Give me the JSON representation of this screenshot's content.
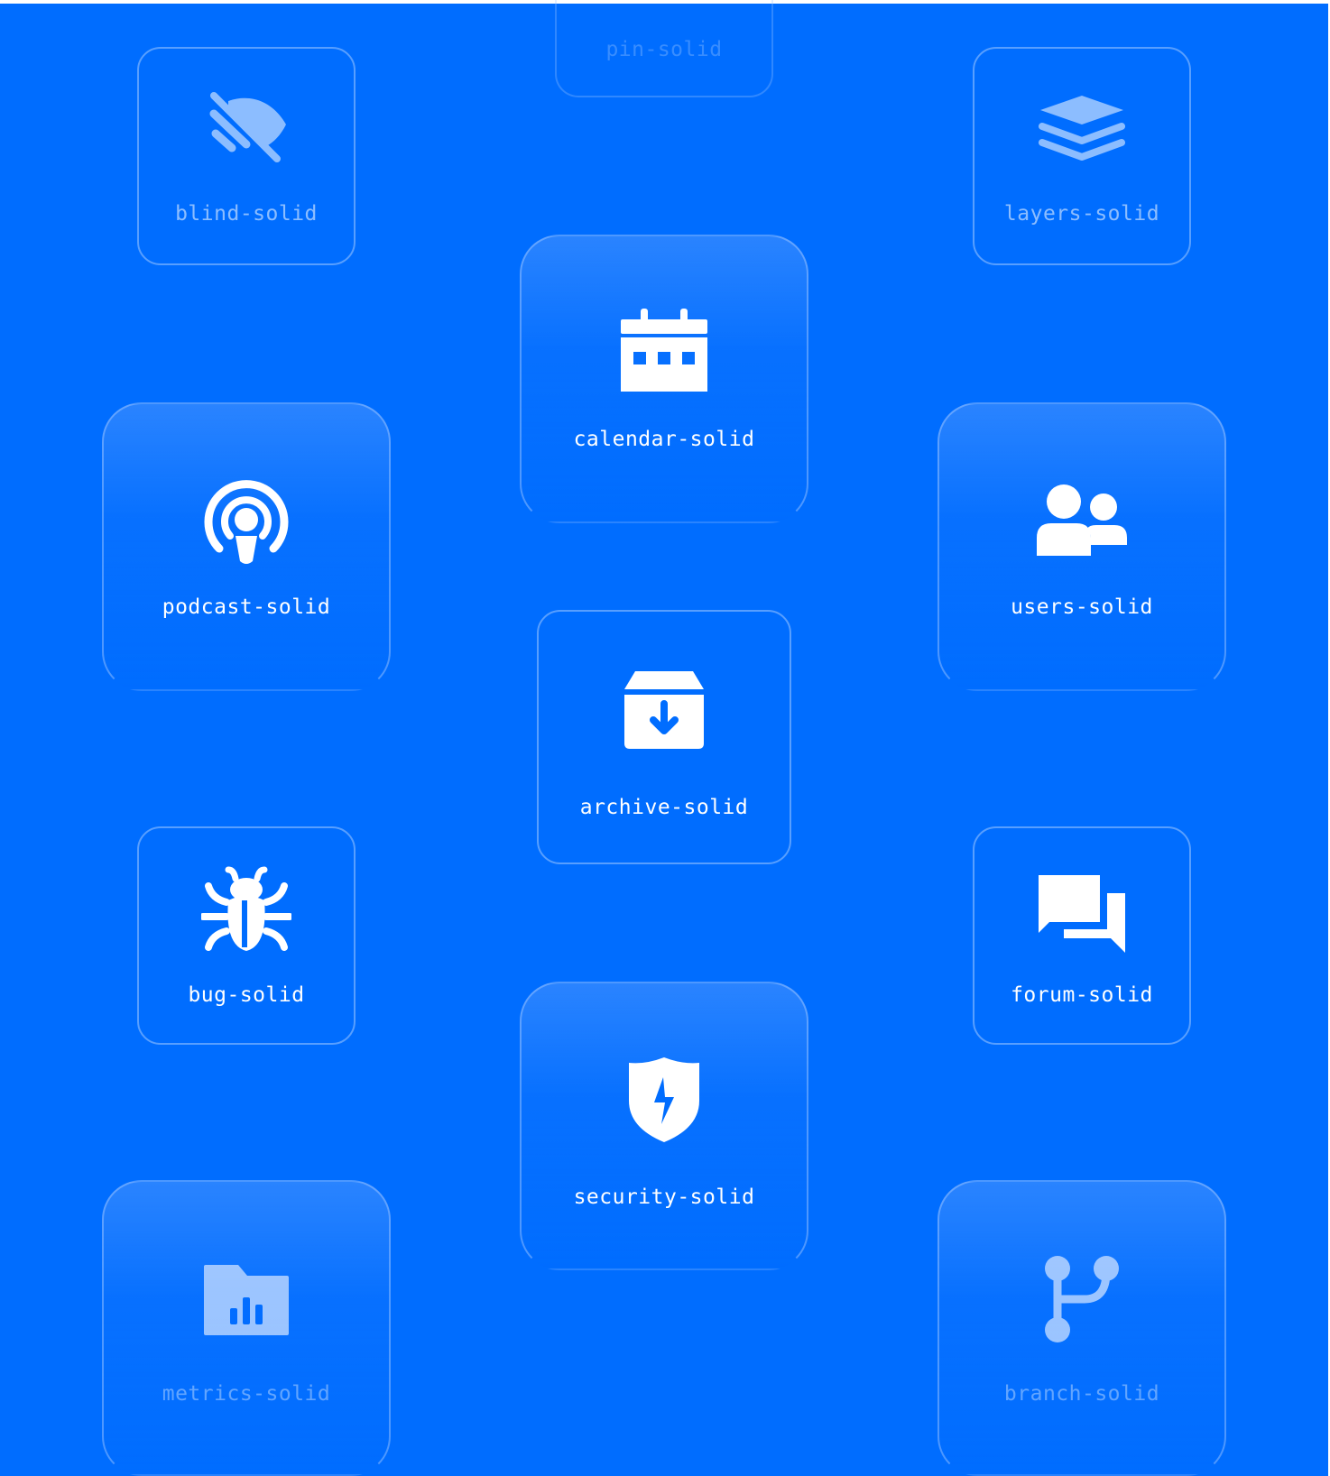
{
  "colors": {
    "background": "#006dff",
    "icon": "#ffffff",
    "card_border": "#a0c8ff"
  },
  "cards": [
    {
      "label": "pin-solid",
      "icon": "pin-icon"
    },
    {
      "label": "blind-solid",
      "icon": "eye-slash-icon"
    },
    {
      "label": "layers-solid",
      "icon": "layers-icon"
    },
    {
      "label": "calendar-solid",
      "icon": "calendar-icon"
    },
    {
      "label": "podcast-solid",
      "icon": "podcast-icon"
    },
    {
      "label": "users-solid",
      "icon": "users-icon"
    },
    {
      "label": "archive-solid",
      "icon": "archive-icon"
    },
    {
      "label": "bug-solid",
      "icon": "bug-icon"
    },
    {
      "label": "forum-solid",
      "icon": "forum-icon"
    },
    {
      "label": "security-solid",
      "icon": "shield-bolt-icon"
    },
    {
      "label": "metrics-solid",
      "icon": "folder-chart-icon"
    },
    {
      "label": "branch-solid",
      "icon": "git-branch-icon"
    }
  ]
}
